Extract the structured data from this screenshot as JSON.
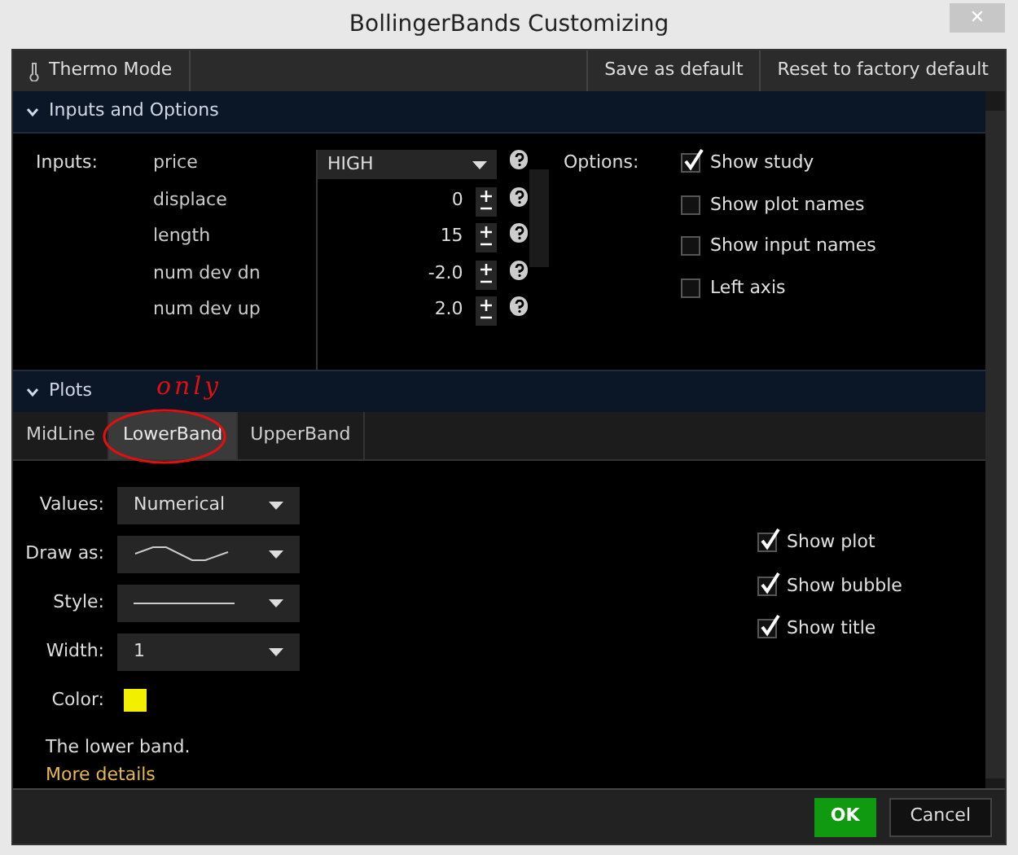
{
  "window": {
    "title": "BollingerBands Customizing",
    "close": "✕"
  },
  "toolbar": {
    "left": [
      {
        "label": "Thermo Mode"
      }
    ],
    "right": [
      {
        "label": "Save as default"
      },
      {
        "label": "Reset to factory default"
      }
    ]
  },
  "inputs_section": {
    "title": "Inputs and Options",
    "expanded": true,
    "inputs_label": "Inputs:",
    "options_label": "Options:",
    "inputs": [
      {
        "name": "price",
        "kind": "dropdown",
        "value": "HIGH"
      },
      {
        "name": "displace",
        "kind": "spinner",
        "value": "0"
      },
      {
        "name": "length",
        "kind": "spinner",
        "value": "15"
      },
      {
        "name": "num dev dn",
        "kind": "spinner",
        "value": "-2.0"
      },
      {
        "name": "num dev up",
        "kind": "spinner",
        "value": "2.0"
      }
    ],
    "options": [
      {
        "label": "Show study",
        "checked": true
      },
      {
        "label": "Show plot names",
        "checked": false
      },
      {
        "label": "Show input names",
        "checked": false
      },
      {
        "label": "Left axis",
        "checked": false
      }
    ]
  },
  "plots_section": {
    "title": "Plots",
    "expanded": true,
    "tabs": [
      {
        "label": "MidLine",
        "selected": false
      },
      {
        "label": "LowerBand",
        "selected": true
      },
      {
        "label": "UpperBand",
        "selected": false
      }
    ],
    "fields": [
      {
        "label": "Values:",
        "kind": "text",
        "value": "Numerical"
      },
      {
        "label": "Draw as:",
        "kind": "curve"
      },
      {
        "label": "Style:",
        "kind": "line"
      },
      {
        "label": "Width:",
        "kind": "text",
        "value": "1"
      },
      {
        "label": "Color:",
        "kind": "color",
        "color": "#f2ef00"
      }
    ],
    "options": [
      {
        "label": "Show plot",
        "checked": true
      },
      {
        "label": "Show bubble",
        "checked": true
      },
      {
        "label": "Show title",
        "checked": true
      }
    ],
    "description": "The lower band.",
    "link": "More details"
  },
  "annotation": {
    "text": "only"
  },
  "buttons": [
    {
      "label": "OK",
      "kind": "primary"
    },
    {
      "label": "Cancel",
      "kind": "secondary"
    }
  ]
}
